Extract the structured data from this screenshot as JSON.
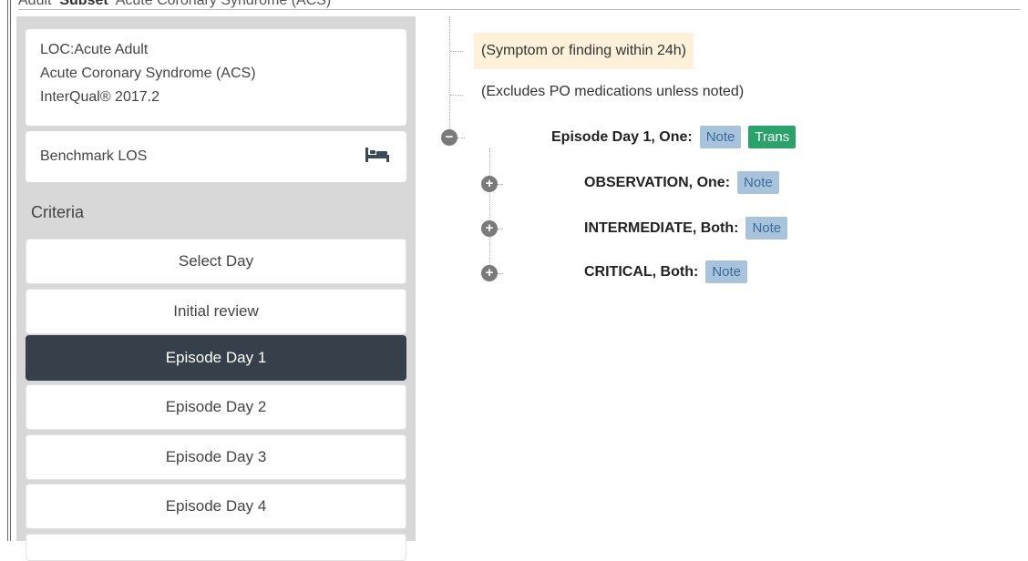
{
  "breadcrumb": {
    "prefix": "Adult",
    "subset_label": "Subset",
    "subset_value": "Acute Coronary Syndrome (ACS)"
  },
  "sidebar": {
    "loc_card": {
      "line1": "LOC:Acute Adult",
      "line2": "Acute Coronary Syndrome (ACS)",
      "line3": "InterQual® 2017.2"
    },
    "benchmark": {
      "label": "Benchmark LOS",
      "icon": "bed-icon"
    },
    "criteria_title": "Criteria",
    "days": [
      {
        "label": "Select Day"
      },
      {
        "label": "Initial review"
      },
      {
        "label": "Episode Day 1",
        "active": true
      },
      {
        "label": "Episode Day 2"
      },
      {
        "label": "Episode Day 3"
      },
      {
        "label": "Episode Day 4"
      }
    ]
  },
  "tree": {
    "note1": "(Symptom or finding within 24h)",
    "note2": "(Excludes PO medications unless noted)",
    "root": {
      "label": "Episode Day 1, One:",
      "note": "Note",
      "trans": "Trans"
    },
    "children": [
      {
        "label": "OBSERVATION, One:",
        "note": "Note"
      },
      {
        "label": "INTERMEDIATE, Both:",
        "note": "Note"
      },
      {
        "label": "CRITICAL, Both:",
        "note": "Note"
      }
    ]
  },
  "colors": {
    "active_day_bg": "#35404a",
    "note_tag_bg": "#a8c4dd",
    "trans_tag_bg": "#29a36a",
    "highlight_bg": "#fdf2d9"
  }
}
